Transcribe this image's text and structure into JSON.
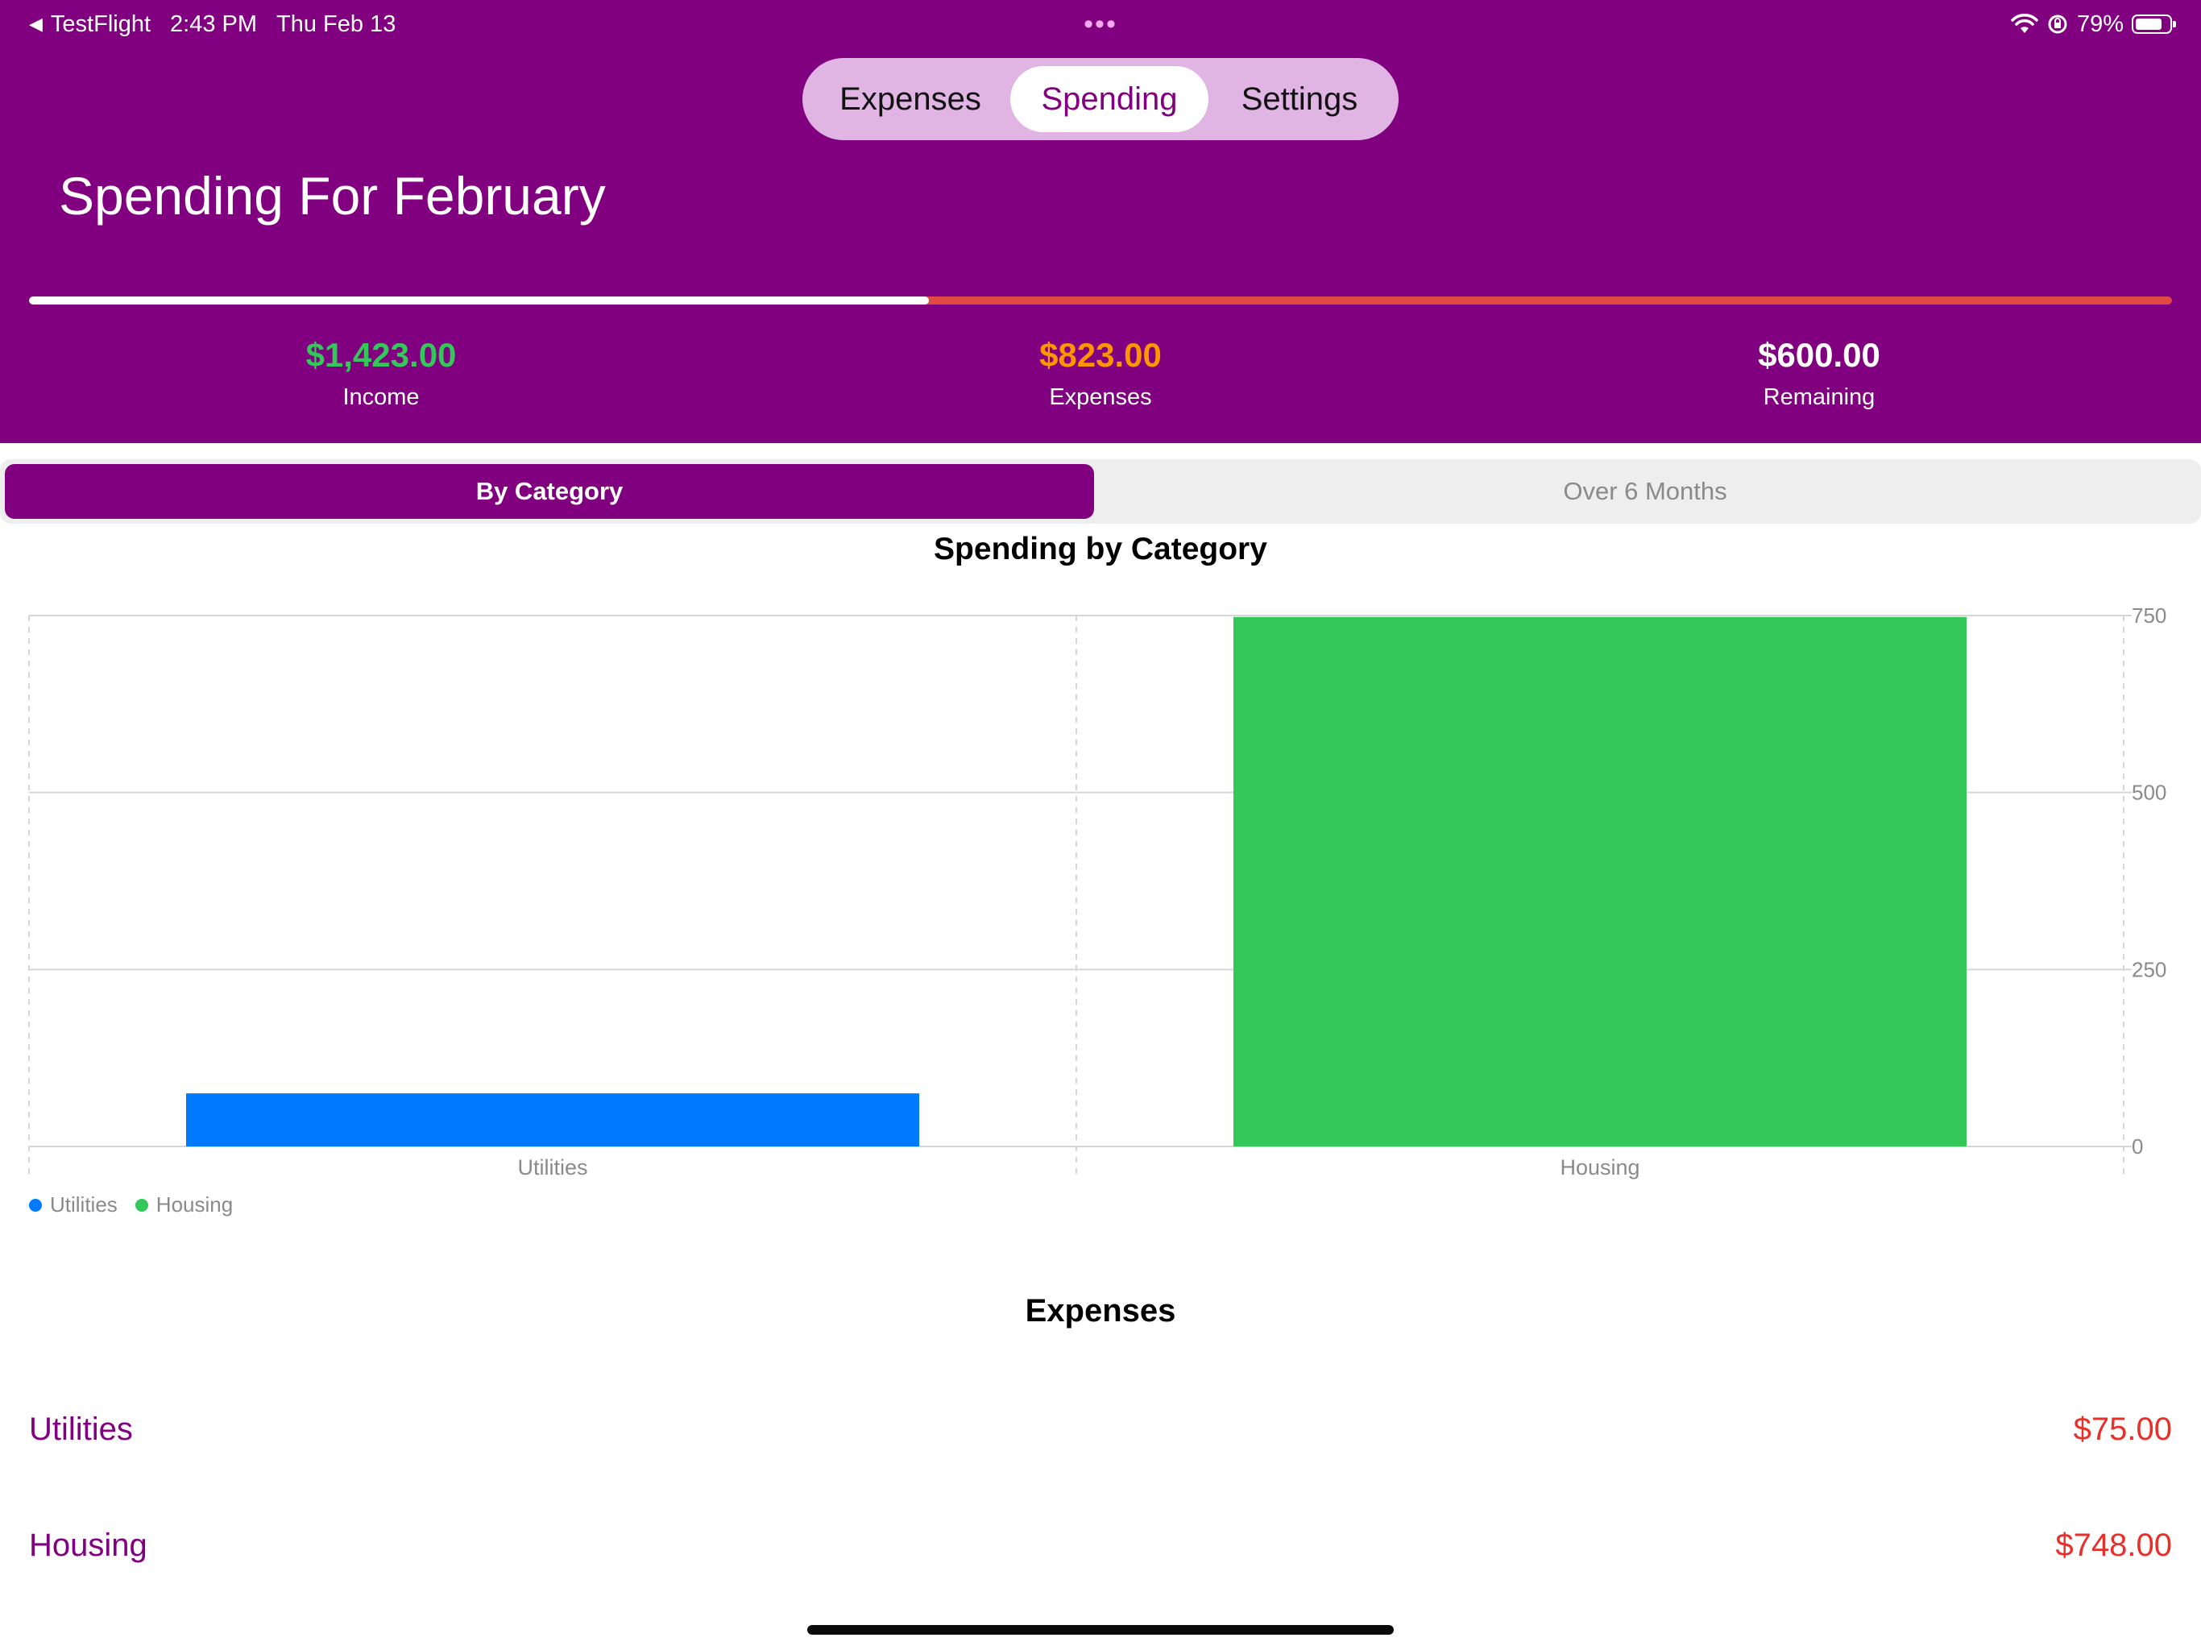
{
  "status_bar": {
    "back_app": "TestFlight",
    "time": "2:43 PM",
    "date": "Thu Feb 13",
    "dots": "•••",
    "battery": "79%",
    "battery_level": 0.79
  },
  "nav": {
    "options": [
      "Expenses",
      "Spending",
      "Settings"
    ],
    "selected": "Spending"
  },
  "page_title": "Spending For February",
  "budget_progress": 0.42,
  "summary": {
    "income": {
      "amount": "$1,423.00",
      "label": "Income",
      "color": "#34c759"
    },
    "expenses": {
      "amount": "$823.00",
      "label": "Expenses",
      "color": "#ff9500"
    },
    "remaining": {
      "amount": "$600.00",
      "label": "Remaining",
      "color": "#ffffff"
    }
  },
  "tabs": {
    "options": [
      "By Category",
      "Over 6 Months"
    ],
    "selected": "By Category"
  },
  "chart_data": {
    "type": "bar",
    "title": "Spending by Category",
    "categories": [
      "Utilities",
      "Housing"
    ],
    "values": [
      75,
      748
    ],
    "colors": [
      "#007aff",
      "#34c759"
    ],
    "ylim": [
      0,
      750
    ],
    "yticks": [
      0,
      250,
      500,
      750
    ],
    "grid": true,
    "legend": [
      "Utilities",
      "Housing"
    ],
    "legend_position": "bottom-left"
  },
  "expenses_list": {
    "title": "Expenses",
    "items": [
      {
        "name": "Utilities",
        "amount": "$75.00"
      },
      {
        "name": "Housing",
        "amount": "$748.00"
      }
    ]
  },
  "colors": {
    "brand": "#80007f",
    "expense_amount": "#e8302b"
  }
}
